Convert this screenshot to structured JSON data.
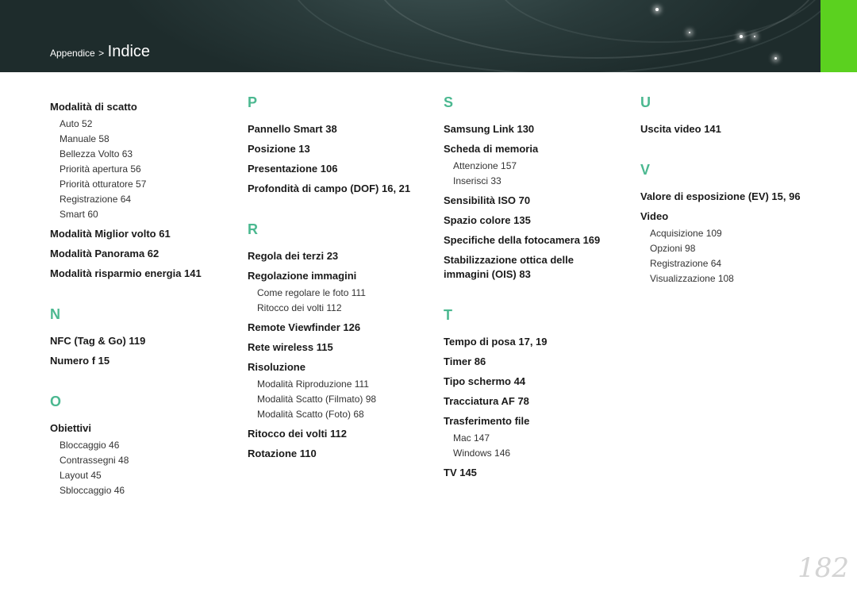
{
  "header": {
    "breadcrumb_parent": "Appendice",
    "breadcrumb_sep": ">",
    "breadcrumb_current": "Indice",
    "accent_color": "#5bd11f",
    "letter_color": "#4bb890"
  },
  "col1": {
    "e1": "Modalità di scatto",
    "e1_subs": [
      "Auto  52",
      "Manuale  58",
      "Bellezza Volto  63",
      "Priorità apertura  56",
      "Priorità otturatore  57",
      "Registrazione  64",
      "Smart  60"
    ],
    "e2": "Modalità Miglior volto  61",
    "e3": "Modalità Panorama  62",
    "e4": "Modalità risparmio energia  141",
    "letter_n": "N",
    "n1": "NFC (Tag & Go)  119",
    "n2": "Numero f  15",
    "letter_o": "O",
    "o1": "Obiettivi",
    "o1_subs": [
      "Bloccaggio  46",
      "Contrassegni  48",
      "Layout  45",
      "Sbloccaggio  46"
    ]
  },
  "col2": {
    "letter_p": "P",
    "p1": "Pannello Smart  38",
    "p2": "Posizione  13",
    "p3": "Presentazione  106",
    "p4": "Profondità di campo (DOF)  16, 21",
    "letter_r": "R",
    "r1": "Regola dei terzi  23",
    "r2": "Regolazione immagini",
    "r2_subs": [
      "Come regolare le foto  111",
      "Ritocco dei volti  112"
    ],
    "r3": "Remote Viewfinder  126",
    "r4": "Rete wireless  115",
    "r5": "Risoluzione",
    "r5_subs": [
      "Modalità Riproduzione  111",
      "Modalità Scatto (Filmato)  98",
      "Modalità Scatto (Foto)  68"
    ],
    "r6": "Ritocco dei volti  112",
    "r7": "Rotazione  110"
  },
  "col3": {
    "letter_s": "S",
    "s1": "Samsung Link  130",
    "s2": "Scheda di memoria",
    "s2_subs": [
      "Attenzione  157",
      "Inserisci  33"
    ],
    "s3": "Sensibilità ISO  70",
    "s4": "Spazio colore  135",
    "s5": "Specifiche della fotocamera  169",
    "s6a": "Stabilizzazione ottica delle",
    "s6b": "immagini (OIS)  83",
    "letter_t": "T",
    "t1": "Tempo di posa  17, 19",
    "t2": "Timer  86",
    "t3": "Tipo schermo  44",
    "t4": "Tracciatura AF  78",
    "t5": "Trasferimento file",
    "t5_subs": [
      "Mac  147",
      "Windows  146"
    ],
    "t6": "TV  145"
  },
  "col4": {
    "letter_u": "U",
    "u1": "Uscita video  141",
    "letter_v": "V",
    "v1": "Valore di esposizione (EV)  15, 96",
    "v2": "Video",
    "v2_subs": [
      "Acquisizione  109",
      "Opzioni  98",
      "Registrazione  64",
      "Visualizzazione  108"
    ]
  },
  "page_number": "182"
}
